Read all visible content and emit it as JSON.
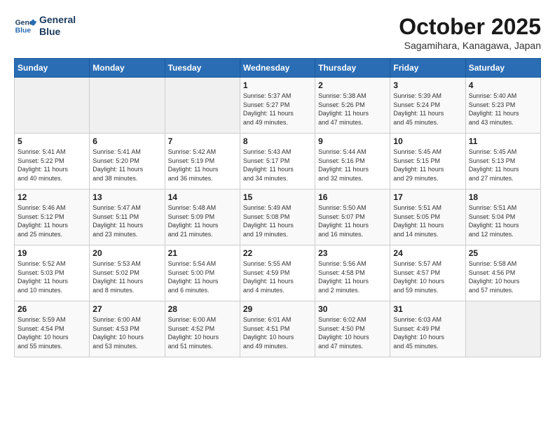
{
  "header": {
    "logo_line1": "General",
    "logo_line2": "Blue",
    "month": "October 2025",
    "location": "Sagamihara, Kanagawa, Japan"
  },
  "weekdays": [
    "Sunday",
    "Monday",
    "Tuesday",
    "Wednesday",
    "Thursday",
    "Friday",
    "Saturday"
  ],
  "weeks": [
    [
      {
        "day": "",
        "info": ""
      },
      {
        "day": "",
        "info": ""
      },
      {
        "day": "",
        "info": ""
      },
      {
        "day": "1",
        "info": "Sunrise: 5:37 AM\nSunset: 5:27 PM\nDaylight: 11 hours\nand 49 minutes."
      },
      {
        "day": "2",
        "info": "Sunrise: 5:38 AM\nSunset: 5:26 PM\nDaylight: 11 hours\nand 47 minutes."
      },
      {
        "day": "3",
        "info": "Sunrise: 5:39 AM\nSunset: 5:24 PM\nDaylight: 11 hours\nand 45 minutes."
      },
      {
        "day": "4",
        "info": "Sunrise: 5:40 AM\nSunset: 5:23 PM\nDaylight: 11 hours\nand 43 minutes."
      }
    ],
    [
      {
        "day": "5",
        "info": "Sunrise: 5:41 AM\nSunset: 5:22 PM\nDaylight: 11 hours\nand 40 minutes."
      },
      {
        "day": "6",
        "info": "Sunrise: 5:41 AM\nSunset: 5:20 PM\nDaylight: 11 hours\nand 38 minutes."
      },
      {
        "day": "7",
        "info": "Sunrise: 5:42 AM\nSunset: 5:19 PM\nDaylight: 11 hours\nand 36 minutes."
      },
      {
        "day": "8",
        "info": "Sunrise: 5:43 AM\nSunset: 5:17 PM\nDaylight: 11 hours\nand 34 minutes."
      },
      {
        "day": "9",
        "info": "Sunrise: 5:44 AM\nSunset: 5:16 PM\nDaylight: 11 hours\nand 32 minutes."
      },
      {
        "day": "10",
        "info": "Sunrise: 5:45 AM\nSunset: 5:15 PM\nDaylight: 11 hours\nand 29 minutes."
      },
      {
        "day": "11",
        "info": "Sunrise: 5:45 AM\nSunset: 5:13 PM\nDaylight: 11 hours\nand 27 minutes."
      }
    ],
    [
      {
        "day": "12",
        "info": "Sunrise: 5:46 AM\nSunset: 5:12 PM\nDaylight: 11 hours\nand 25 minutes."
      },
      {
        "day": "13",
        "info": "Sunrise: 5:47 AM\nSunset: 5:11 PM\nDaylight: 11 hours\nand 23 minutes."
      },
      {
        "day": "14",
        "info": "Sunrise: 5:48 AM\nSunset: 5:09 PM\nDaylight: 11 hours\nand 21 minutes."
      },
      {
        "day": "15",
        "info": "Sunrise: 5:49 AM\nSunset: 5:08 PM\nDaylight: 11 hours\nand 19 minutes."
      },
      {
        "day": "16",
        "info": "Sunrise: 5:50 AM\nSunset: 5:07 PM\nDaylight: 11 hours\nand 16 minutes."
      },
      {
        "day": "17",
        "info": "Sunrise: 5:51 AM\nSunset: 5:05 PM\nDaylight: 11 hours\nand 14 minutes."
      },
      {
        "day": "18",
        "info": "Sunrise: 5:51 AM\nSunset: 5:04 PM\nDaylight: 11 hours\nand 12 minutes."
      }
    ],
    [
      {
        "day": "19",
        "info": "Sunrise: 5:52 AM\nSunset: 5:03 PM\nDaylight: 11 hours\nand 10 minutes."
      },
      {
        "day": "20",
        "info": "Sunrise: 5:53 AM\nSunset: 5:02 PM\nDaylight: 11 hours\nand 8 minutes."
      },
      {
        "day": "21",
        "info": "Sunrise: 5:54 AM\nSunset: 5:00 PM\nDaylight: 11 hours\nand 6 minutes."
      },
      {
        "day": "22",
        "info": "Sunrise: 5:55 AM\nSunset: 4:59 PM\nDaylight: 11 hours\nand 4 minutes."
      },
      {
        "day": "23",
        "info": "Sunrise: 5:56 AM\nSunset: 4:58 PM\nDaylight: 11 hours\nand 2 minutes."
      },
      {
        "day": "24",
        "info": "Sunrise: 5:57 AM\nSunset: 4:57 PM\nDaylight: 10 hours\nand 59 minutes."
      },
      {
        "day": "25",
        "info": "Sunrise: 5:58 AM\nSunset: 4:56 PM\nDaylight: 10 hours\nand 57 minutes."
      }
    ],
    [
      {
        "day": "26",
        "info": "Sunrise: 5:59 AM\nSunset: 4:54 PM\nDaylight: 10 hours\nand 55 minutes."
      },
      {
        "day": "27",
        "info": "Sunrise: 6:00 AM\nSunset: 4:53 PM\nDaylight: 10 hours\nand 53 minutes."
      },
      {
        "day": "28",
        "info": "Sunrise: 6:00 AM\nSunset: 4:52 PM\nDaylight: 10 hours\nand 51 minutes."
      },
      {
        "day": "29",
        "info": "Sunrise: 6:01 AM\nSunset: 4:51 PM\nDaylight: 10 hours\nand 49 minutes."
      },
      {
        "day": "30",
        "info": "Sunrise: 6:02 AM\nSunset: 4:50 PM\nDaylight: 10 hours\nand 47 minutes."
      },
      {
        "day": "31",
        "info": "Sunrise: 6:03 AM\nSunset: 4:49 PM\nDaylight: 10 hours\nand 45 minutes."
      },
      {
        "day": "",
        "info": ""
      }
    ]
  ]
}
